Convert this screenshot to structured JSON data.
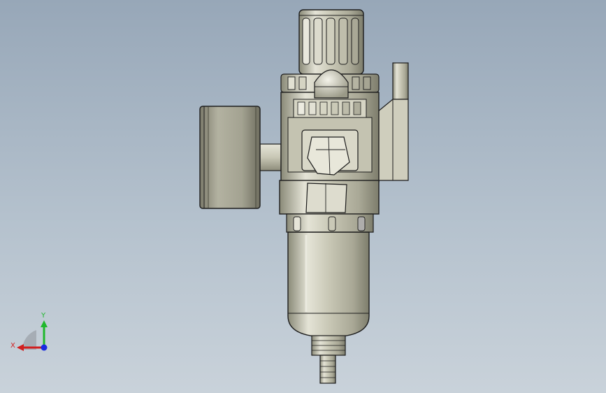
{
  "viewport": {
    "background_top": "#97a7b8",
    "background_bottom": "#c9d2da"
  },
  "model": {
    "name": "air-filter-regulator-with-gauge",
    "metal_color": "#c9c8b6",
    "edge_color": "#1c1c1c"
  },
  "triad": {
    "x_label": "X",
    "y_label": "Y",
    "x_color": "#d11f1f",
    "y_color": "#1fb82c",
    "z_color": "#1a2be0"
  }
}
